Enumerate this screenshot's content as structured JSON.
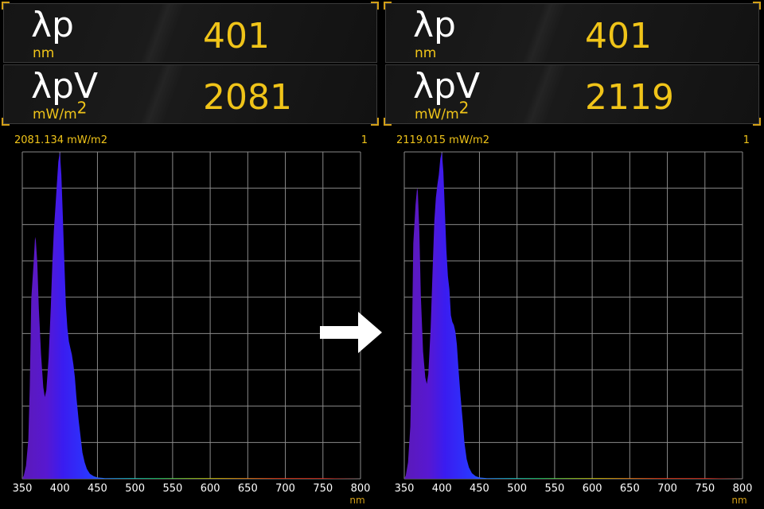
{
  "colors": {
    "accent": "#f0c419",
    "background": "#000000",
    "grid": "#8a8a8a"
  },
  "panels": [
    {
      "lp_symbol": "λp",
      "lp_unit": "nm",
      "lp_value": "401",
      "lpv_symbol": "λpV",
      "lpv_unit": "mW/m",
      "lpv_unit_sup": "2",
      "lpv_value": "2081",
      "info_text": "2081.134  mW/m2",
      "info_num": "1"
    },
    {
      "lp_symbol": "λp",
      "lp_unit": "nm",
      "lp_value": "401",
      "lpv_symbol": "λpV",
      "lpv_unit": "mW/m",
      "lpv_unit_sup": "2",
      "lpv_value": "2119",
      "info_text": "2119.015  mW/m2",
      "info_num": "1"
    }
  ],
  "arrow_icon": "right-arrow-icon",
  "chart_data": [
    {
      "type": "area",
      "xlabel": "nm",
      "xlim": [
        350,
        800
      ],
      "ylim": [
        0,
        1
      ],
      "grid": true,
      "x_ticks": [
        350,
        400,
        450,
        500,
        550,
        600,
        650,
        700,
        750,
        800
      ],
      "x": [
        350,
        352,
        355,
        358,
        360,
        362,
        365,
        367,
        368,
        370,
        372,
        375,
        378,
        380,
        382,
        385,
        388,
        390,
        392,
        394,
        396,
        398,
        400,
        402,
        404,
        406,
        408,
        410,
        412,
        414,
        416,
        418,
        420,
        422,
        425,
        428,
        430,
        433,
        436,
        440,
        445,
        450,
        460,
        500,
        550,
        600,
        650,
        700,
        750,
        800
      ],
      "y": [
        0.0,
        0.01,
        0.04,
        0.12,
        0.28,
        0.55,
        0.66,
        0.74,
        0.73,
        0.66,
        0.52,
        0.38,
        0.28,
        0.25,
        0.27,
        0.37,
        0.53,
        0.66,
        0.76,
        0.83,
        0.9,
        0.97,
        1.0,
        0.93,
        0.8,
        0.66,
        0.53,
        0.46,
        0.42,
        0.4,
        0.38,
        0.35,
        0.31,
        0.25,
        0.18,
        0.12,
        0.08,
        0.05,
        0.03,
        0.015,
        0.008,
        0.004,
        0.002,
        0.002,
        0.002,
        0.002,
        0.002,
        0.002,
        0.002,
        0.0
      ]
    },
    {
      "type": "area",
      "xlabel": "nm",
      "xlim": [
        350,
        800
      ],
      "ylim": [
        0,
        1
      ],
      "grid": true,
      "x_ticks": [
        350,
        400,
        450,
        500,
        550,
        600,
        650,
        700,
        750,
        800
      ],
      "x": [
        350,
        352,
        355,
        358,
        360,
        362,
        365,
        367,
        368,
        370,
        372,
        375,
        378,
        380,
        382,
        385,
        388,
        390,
        392,
        394,
        396,
        398,
        400,
        402,
        404,
        406,
        408,
        410,
        412,
        414,
        416,
        418,
        420,
        422,
        425,
        428,
        430,
        433,
        436,
        440,
        445,
        450,
        460,
        500,
        550,
        600,
        650,
        700,
        750,
        800
      ],
      "y": [
        0.0,
        0.01,
        0.05,
        0.16,
        0.38,
        0.72,
        0.84,
        0.89,
        0.88,
        0.76,
        0.56,
        0.39,
        0.31,
        0.29,
        0.32,
        0.46,
        0.66,
        0.79,
        0.86,
        0.9,
        0.93,
        0.98,
        1.0,
        0.94,
        0.82,
        0.7,
        0.62,
        0.58,
        0.5,
        0.48,
        0.47,
        0.45,
        0.41,
        0.34,
        0.25,
        0.17,
        0.11,
        0.06,
        0.035,
        0.017,
        0.008,
        0.004,
        0.002,
        0.002,
        0.002,
        0.002,
        0.002,
        0.002,
        0.002,
        0.0
      ]
    }
  ]
}
